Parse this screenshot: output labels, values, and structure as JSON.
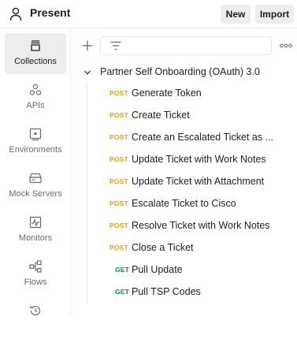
{
  "workspace": {
    "title": "Present",
    "icon": "user-icon"
  },
  "header": {
    "new_label": "New",
    "import_label": "Import"
  },
  "sidebar": {
    "items": [
      {
        "label": "Collections",
        "icon": "collections-icon",
        "active": true
      },
      {
        "label": "APIs",
        "icon": "apis-icon"
      },
      {
        "label": "Environments",
        "icon": "environments-icon"
      },
      {
        "label": "Mock Servers",
        "icon": "mock-servers-icon"
      },
      {
        "label": "Monitors",
        "icon": "monitors-icon"
      },
      {
        "label": "Flows",
        "icon": "flows-icon"
      },
      {
        "label": "",
        "icon": "history-icon"
      }
    ]
  },
  "collection": {
    "name": "Partner Self Onboarding (OAuth) 3.0",
    "requests": [
      {
        "method": "POST",
        "name": "Generate Token"
      },
      {
        "method": "POST",
        "name": "Create Ticket"
      },
      {
        "method": "POST",
        "name": "Create an Escalated Ticket as ..."
      },
      {
        "method": "POST",
        "name": "Update Ticket with Work Notes"
      },
      {
        "method": "POST",
        "name": "Update Ticket with Attachment"
      },
      {
        "method": "POST",
        "name": "Escalate Ticket to Cisco"
      },
      {
        "method": "POST",
        "name": "Resolve Ticket with Work Notes"
      },
      {
        "method": "POST",
        "name": "Close a Ticket"
      },
      {
        "method": "GET",
        "name": "Pull Update"
      },
      {
        "method": "GET",
        "name": "Pull TSP Codes"
      }
    ]
  },
  "colors": {
    "post": "#e0a312",
    "get": "#0b8a4f",
    "active_bg": "#ededed"
  }
}
